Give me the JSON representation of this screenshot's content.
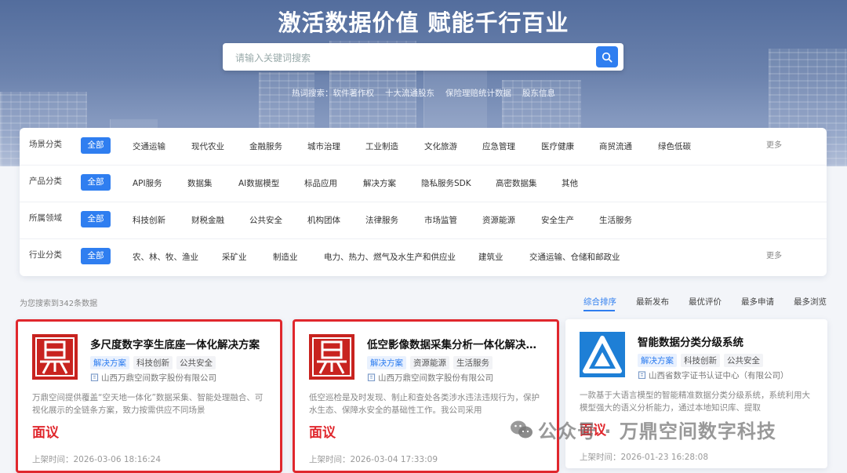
{
  "hero": {
    "title": "激活数据价值 赋能千行百业",
    "search_placeholder": "请输入关键词搜索",
    "hot_label": "热词搜索：",
    "hot_words": [
      "软件著作权",
      "十大流通股东",
      "保险理赔统计数据",
      "股东信息"
    ]
  },
  "filters": {
    "all_label": "全部",
    "more_label": "更多",
    "rows": [
      {
        "label": "场景分类",
        "options": [
          "交通运输",
          "现代农业",
          "金融服务",
          "城市治理",
          "工业制造",
          "文化旅游",
          "应急管理",
          "医疗健康",
          "商贸流通",
          "绿色低碳"
        ],
        "has_more": true
      },
      {
        "label": "产品分类",
        "options": [
          "API服务",
          "数据集",
          "AI数据模型",
          "标品应用",
          "解决方案",
          "隐私服务SDK",
          "高密数据集",
          "其他"
        ],
        "has_more": false
      },
      {
        "label": "所属领域",
        "options": [
          "科技创新",
          "财税金融",
          "公共安全",
          "机构团体",
          "法律服务",
          "市场监管",
          "资源能源",
          "安全生产",
          "生活服务"
        ],
        "has_more": false
      },
      {
        "label": "行业分类",
        "options": [
          "农、林、牧、渔业",
          "采矿业",
          "制造业",
          "电力、热力、燃气及水生产和供应业",
          "建筑业",
          "交通运输、仓储和邮政业"
        ],
        "has_more": true
      }
    ]
  },
  "results": {
    "count_text": "为您搜索到342条数据",
    "sort_options": [
      "综合排序",
      "最新发布",
      "最优评价",
      "最多申请",
      "最多浏览"
    ],
    "active_sort": "综合排序"
  },
  "cards": [
    {
      "title": "多尺度数字孪生底座一体化解决方案",
      "tags": [
        "解决方案",
        "科技创新",
        "公共安全"
      ],
      "company": "山西万鼎空间数字股份有限公司",
      "desc": "万鼎空间提供覆盖“空天地一体化”数据采集、智能处理融合、可视化展示的全链条方案，致力按需供应不同场景",
      "price": "面议",
      "time": "上架时间：2026-03-06 18:16:24",
      "logo": "dingding-logo-red",
      "highlighted": true
    },
    {
      "title": "低空影像数据采集分析一体化解决方案",
      "tags": [
        "解决方案",
        "资源能源",
        "生活服务"
      ],
      "company": "山西万鼎空间数字股份有限公司",
      "desc": "低空巡检是及时发现、制止和查处各类涉水违法违规行为，保护水生态、保障水安全的基础性工作。我公司采用",
      "price": "面议",
      "time": "上架时间：2026-03-04 17:33:09",
      "logo": "dingding-logo-red",
      "highlighted": true
    },
    {
      "title": "智能数据分类分级系统",
      "tags": [
        "解决方案",
        "科技创新",
        "公共安全"
      ],
      "company": "山西省数字证书认证中心（有限公司）",
      "desc": "一款基于大语言模型的智能精准数据分类分级系统，系统利用大模型强大的语义分析能力，通过本地知识库、提取",
      "price": "面议",
      "time": "上架时间：2026-01-23 16:28:08",
      "logo": "triangle-logo-blue",
      "highlighted": false
    }
  ],
  "watermark": "公众号 · 万鼎空间数字科技",
  "colors": {
    "accent": "#2f7ef0",
    "highlight": "#e0272d",
    "hero": "#536d9d"
  }
}
